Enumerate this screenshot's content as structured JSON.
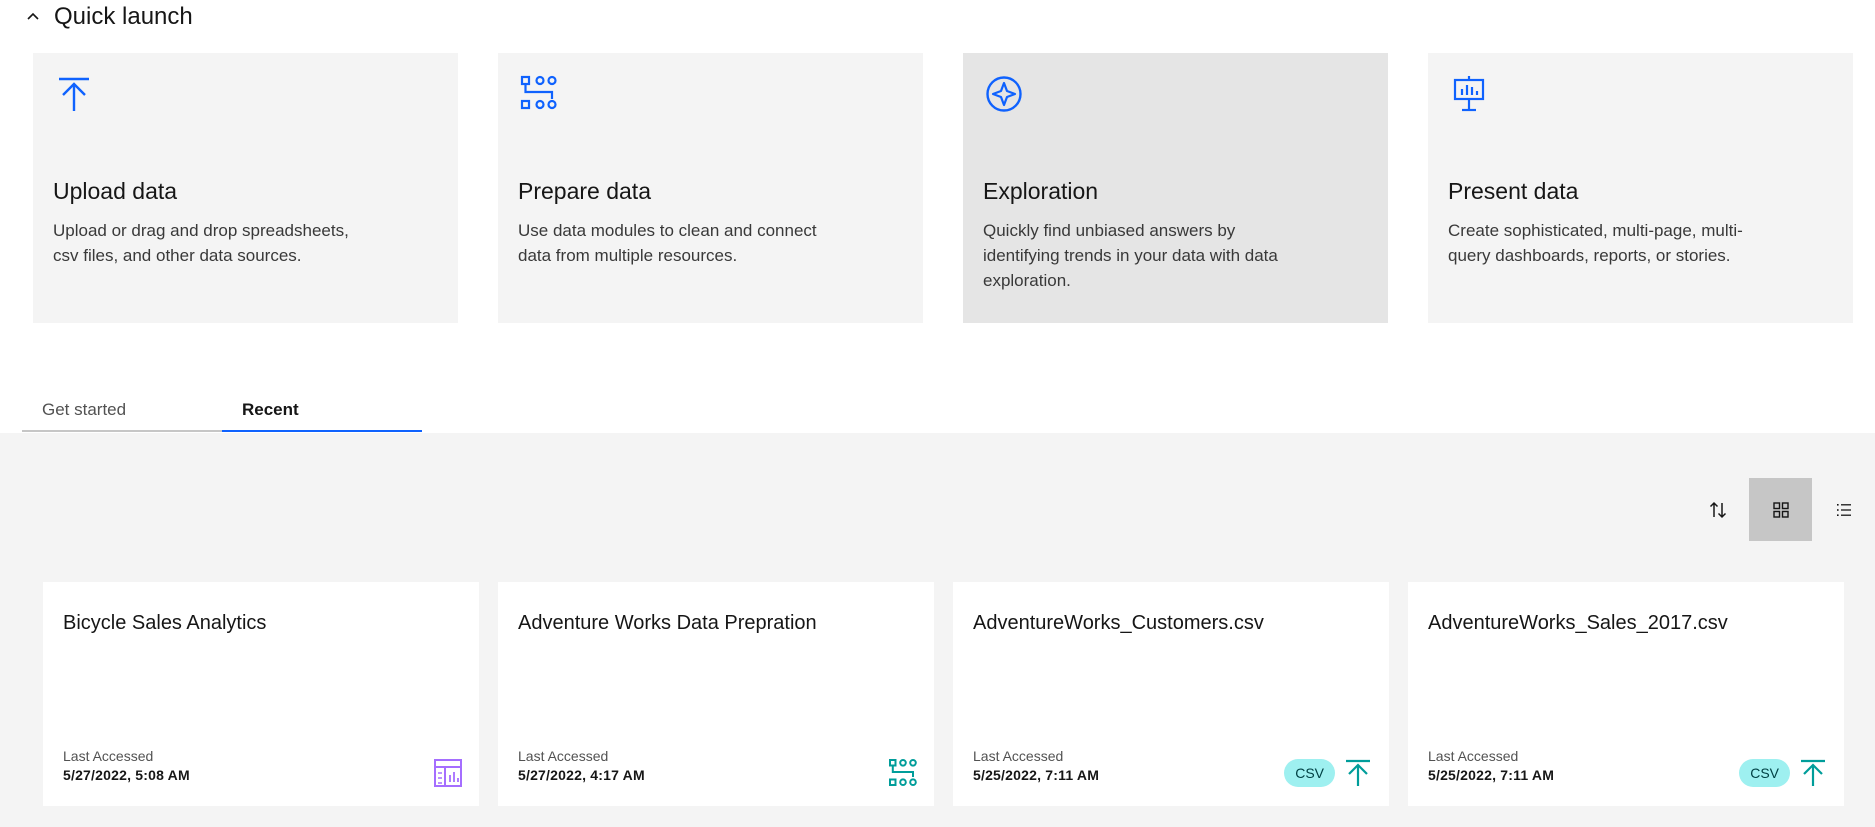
{
  "quick_launch": {
    "title": "Quick launch",
    "tiles": [
      {
        "title": "Upload data",
        "description": "Upload or drag and drop spreadsheets, csv files, and other data sources.",
        "icon": "upload-icon"
      },
      {
        "title": "Prepare data",
        "description": "Use data modules to clean and connect data from multiple resources.",
        "icon": "data-module-icon"
      },
      {
        "title": "Exploration",
        "description": "Quickly find unbiased answers by identifying trends in your data with data exploration.",
        "icon": "exploration-icon"
      },
      {
        "title": "Present data",
        "description": "Create sophisticated, multi-page, multi-query dashboards, reports, or stories.",
        "icon": "presentation-icon"
      }
    ]
  },
  "tabs": [
    {
      "label": "Get started",
      "active": false
    },
    {
      "label": "Recent",
      "active": true
    }
  ],
  "toolbar": {
    "sort_icon": "sort-icon",
    "grid_icon": "grid-view-icon",
    "list_icon": "list-view-icon",
    "active_view": "grid"
  },
  "recent": {
    "accessed_label": "Last Accessed",
    "items": [
      {
        "name": "Bicycle Sales Analytics",
        "date": "5/27/2022, 5:08 AM",
        "icon": "dashboard-icon",
        "badge": ""
      },
      {
        "name": "Adventure Works Data Prepration",
        "date": "5/27/2022, 4:17 AM",
        "icon": "data-module-icon",
        "badge": ""
      },
      {
        "name": "AdventureWorks_Customers.csv",
        "date": "5/25/2022, 7:11 AM",
        "icon": "upload-icon",
        "badge": "CSV"
      },
      {
        "name": "AdventureWorks_Sales_2017.csv",
        "date": "5/25/2022, 7:11 AM",
        "icon": "upload-icon",
        "badge": "CSV"
      }
    ]
  },
  "colors": {
    "accent": "#0f62fe",
    "teal": "#009d9a",
    "purple": "#a56eff",
    "badge_bg": "#9ef0f0"
  }
}
